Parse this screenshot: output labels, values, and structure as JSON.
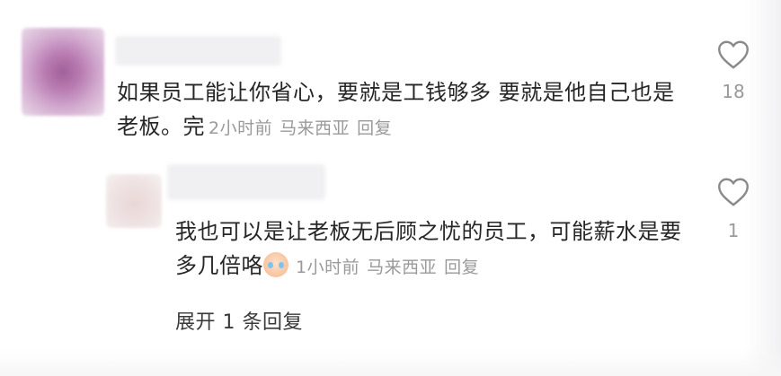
{
  "comment": {
    "text": "如果员工能让你省心，要就是工钱够多 要就是他自己也是老板。完",
    "time": "2小时前",
    "location": "马来西亚",
    "reply_label": "回复",
    "likes": "18"
  },
  "reply": {
    "text": "我也可以是让老板无后顾之忧的员工，可能薪水是要多几倍咯",
    "emoji": "crying-laughing-emoji",
    "time": "1小时前",
    "location": "马来西亚",
    "reply_label": "回复",
    "likes": "1"
  },
  "expand_label": "展开 1 条回复",
  "colors": {
    "text": "#262626",
    "meta": "#9a9a9a",
    "heart_outline": "#8a8a8a"
  }
}
